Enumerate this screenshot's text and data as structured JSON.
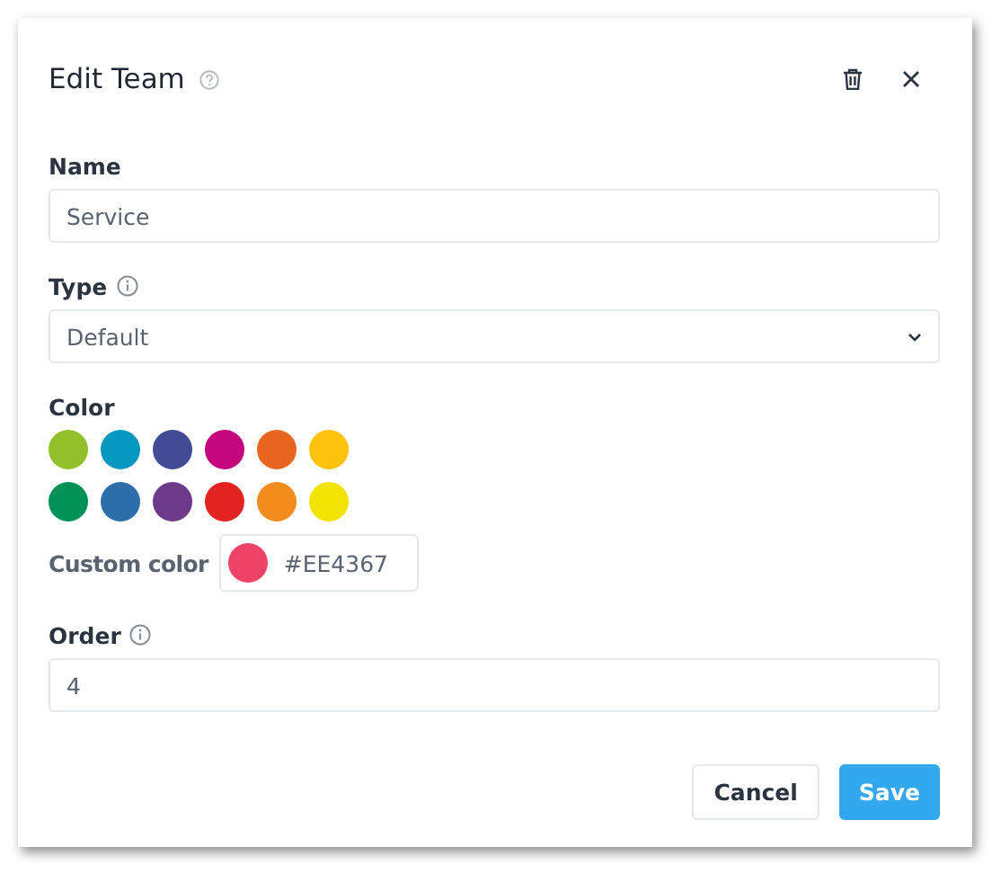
{
  "dialog": {
    "title": "Edit Team"
  },
  "fields": [
    {
      "kind": "text",
      "label": "Name",
      "value": "Service"
    },
    {
      "kind": "select",
      "label": "Type",
      "info": true,
      "value": "Default"
    },
    {
      "kind": "colors",
      "label": "Color",
      "swatches": [
        {
          "color": "#93c02a"
        },
        {
          "color": "#0897c0"
        },
        {
          "color": "#434b95"
        },
        {
          "color": "#c4077d"
        },
        {
          "color": "#e8651f"
        },
        {
          "color": "#fdc20b"
        },
        {
          "color": "#029156"
        },
        {
          "color": "#2b6eaa"
        },
        {
          "color": "#6d3a8b"
        },
        {
          "color": "#e32222"
        },
        {
          "color": "#f18c1d"
        },
        {
          "color": "#f3e400"
        }
      ],
      "custom_label": "Custom color",
      "custom_value": "#EE4367"
    },
    {
      "kind": "text",
      "label": "Order",
      "info": true,
      "value": "4"
    }
  ],
  "buttons": [
    {
      "kind": "secondary",
      "label": "Cancel"
    },
    {
      "kind": "primary",
      "label": "Save"
    }
  ]
}
